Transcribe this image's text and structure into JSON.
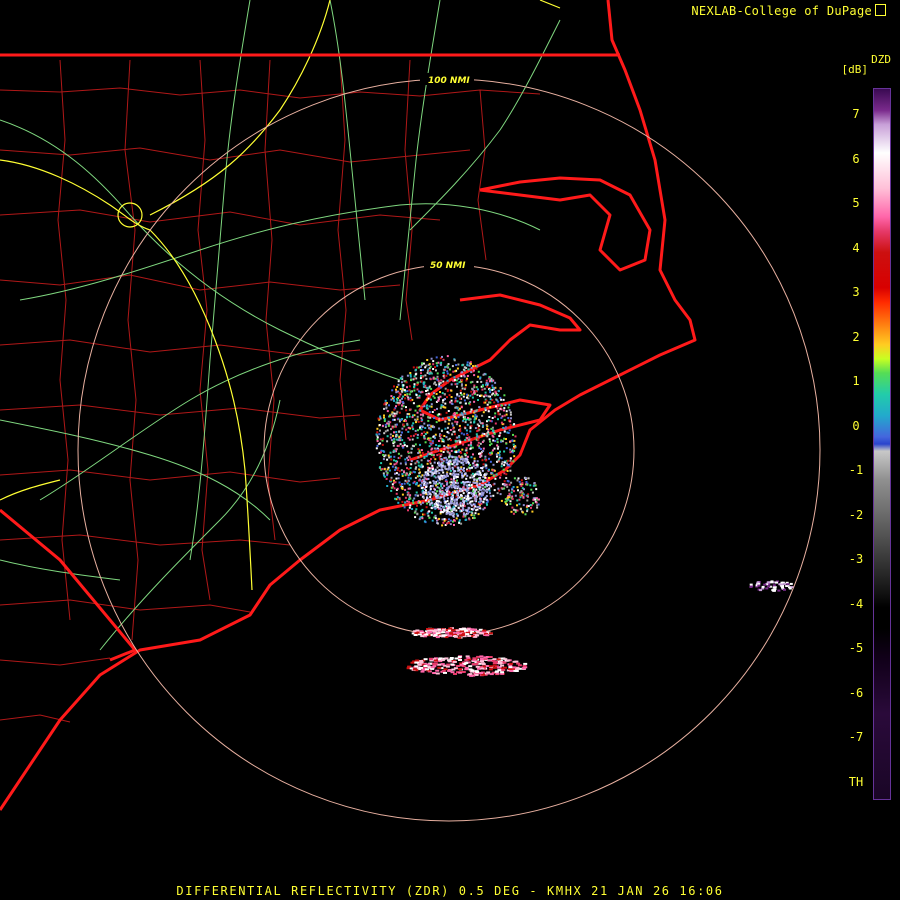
{
  "header": {
    "credit": "NEXLAB-College of DuPage"
  },
  "footer": {
    "caption": "DIFFERENTIAL REFLECTIVITY (ZDR) 0.5 DEG - KMHX 21 JAN 26 16:06"
  },
  "colorbar": {
    "product": "DZD",
    "unit": "[dB]",
    "ticks": [
      "7",
      "6",
      "5",
      "4",
      "3",
      "2",
      "1",
      "0",
      "-1",
      "-2",
      "-3",
      "-4",
      "-5",
      "-6",
      "-7",
      "TH"
    ]
  },
  "range_rings": [
    "50 NMI",
    "100 NMI"
  ],
  "colors": {
    "state_border": "#ff1a1a",
    "county_border": "#b01818",
    "highway": "#7fd77f",
    "interstate": "#ffff33",
    "range_ring": "#e8b0a0",
    "text": "#ffff33"
  },
  "icons": [
    "logo-icon"
  ]
}
